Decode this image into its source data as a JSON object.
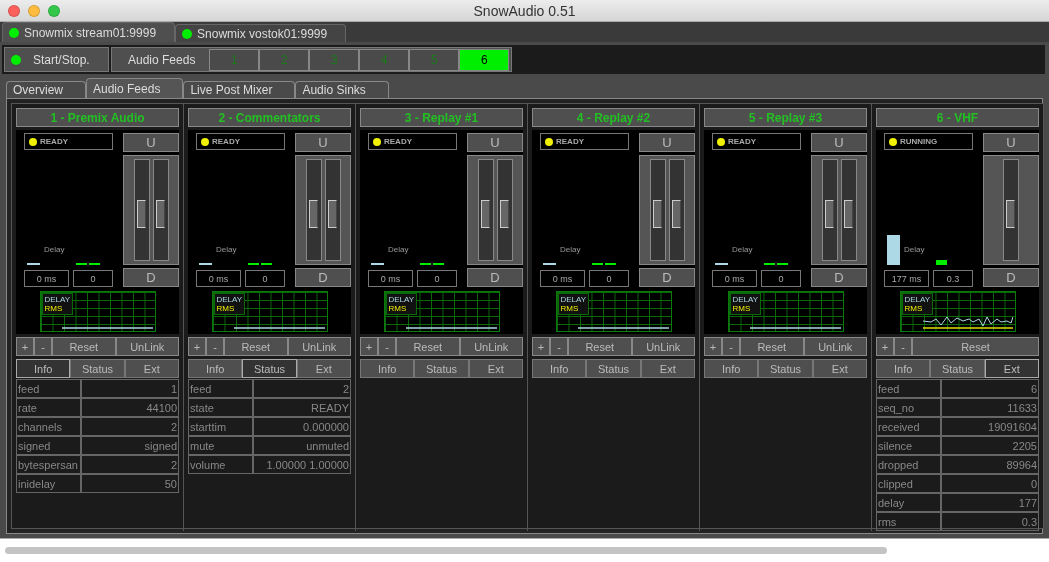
{
  "window": {
    "title": "SnowAudio 0.51"
  },
  "connections": [
    {
      "label": "Snowmix stream01:9999",
      "selected": true
    },
    {
      "label": "Snowmix vostok01:9999",
      "selected": false
    }
  ],
  "toolbar": {
    "start_stop": "Start/Stop.",
    "feeds_label": "Audio Feeds",
    "feed_buttons": [
      {
        "label": "1",
        "selected": false
      },
      {
        "label": "2",
        "selected": false
      },
      {
        "label": "3",
        "selected": false
      },
      {
        "label": "4",
        "selected": false
      },
      {
        "label": "5",
        "selected": false
      },
      {
        "label": "6",
        "selected": true
      }
    ]
  },
  "tabs": [
    {
      "label": "Overview",
      "selected": false
    },
    {
      "label": "Audio Feeds",
      "selected": true
    },
    {
      "label": "Live Post Mixer",
      "selected": false
    },
    {
      "label": "Audio Sinks",
      "selected": false
    }
  ],
  "feeds": [
    {
      "title": "1 - Premix Audio",
      "status": "READY",
      "up": "U",
      "down": "D",
      "faders": [
        {
          "level": 0.5
        },
        {
          "level": 0.5
        }
      ],
      "delay_label": "Delay",
      "delay": "0 ms",
      "rms": "0",
      "legend": [
        "DELAY",
        "RMS"
      ],
      "signal": false,
      "buttons": [
        "+",
        "-",
        "Reset",
        "UnLink"
      ],
      "tabs": [
        {
          "label": "Info",
          "selected": true
        },
        {
          "label": "Status",
          "selected": false
        },
        {
          "label": "Ext",
          "selected": false
        }
      ],
      "table": [
        {
          "key": "feed",
          "value": "1"
        },
        {
          "key": "rate",
          "value": "44100"
        },
        {
          "key": "channels",
          "value": "2"
        },
        {
          "key": "signed",
          "value": "signed"
        },
        {
          "key": "bytespersan",
          "value": "2"
        },
        {
          "key": "inidelay",
          "value": "50"
        }
      ]
    },
    {
      "title": "2 - Commentators",
      "status": "READY",
      "up": "U",
      "down": "D",
      "faders": [
        {
          "level": 0.5
        },
        {
          "level": 0.5
        }
      ],
      "delay_label": "Delay",
      "delay": "0 ms",
      "rms": "0",
      "legend": [
        "DELAY",
        "RMS"
      ],
      "signal": false,
      "buttons": [
        "+",
        "-",
        "Reset",
        "UnLink"
      ],
      "tabs": [
        {
          "label": "Info",
          "selected": false
        },
        {
          "label": "Status",
          "selected": true
        },
        {
          "label": "Ext",
          "selected": false
        }
      ],
      "table": [
        {
          "key": "feed",
          "value": "2"
        },
        {
          "key": "state",
          "value": "READY"
        },
        {
          "key": "starttim",
          "value": "0.000000"
        },
        {
          "key": "mute",
          "value": "unmuted"
        },
        {
          "key": "volume",
          "value": "1.00000 1.00000"
        }
      ]
    },
    {
      "title": "3 - Replay #1",
      "status": "READY",
      "up": "U",
      "down": "D",
      "faders": [
        {
          "level": 0.5
        },
        {
          "level": 0.5
        }
      ],
      "delay_label": "Delay",
      "delay": "0 ms",
      "rms": "0",
      "legend": [
        "DELAY",
        "RMS"
      ],
      "signal": false,
      "buttons": [
        "+",
        "-",
        "Reset",
        "UnLink"
      ],
      "tabs": [
        {
          "label": "Info",
          "selected": false
        },
        {
          "label": "Status",
          "selected": false
        },
        {
          "label": "Ext",
          "selected": false
        }
      ]
    },
    {
      "title": "4 - Replay #2",
      "status": "READY",
      "up": "U",
      "down": "D",
      "faders": [
        {
          "level": 0.5
        },
        {
          "level": 0.5
        }
      ],
      "delay_label": "Delay",
      "delay": "0 ms",
      "rms": "0",
      "legend": [
        "DELAY",
        "RMS"
      ],
      "signal": false,
      "buttons": [
        "+",
        "-",
        "Reset",
        "UnLink"
      ],
      "tabs": [
        {
          "label": "Info",
          "selected": false
        },
        {
          "label": "Status",
          "selected": false
        },
        {
          "label": "Ext",
          "selected": false
        }
      ]
    },
    {
      "title": "5 - Replay #3",
      "status": "READY",
      "up": "U",
      "down": "D",
      "faders": [
        {
          "level": 0.5
        },
        {
          "level": 0.5
        }
      ],
      "delay_label": "Delay",
      "delay": "0 ms",
      "rms": "0",
      "legend": [
        "DELAY",
        "RMS"
      ],
      "signal": false,
      "buttons": [
        "+",
        "-",
        "Reset",
        "UnLink"
      ],
      "tabs": [
        {
          "label": "Info",
          "selected": false
        },
        {
          "label": "Status",
          "selected": false
        },
        {
          "label": "Ext",
          "selected": false
        }
      ]
    },
    {
      "title": "6 - VHF",
      "status": "RUNNING",
      "up": "U",
      "down": "D",
      "faders": [
        {
          "level": 0.5
        }
      ],
      "delay_label": "Delay",
      "delay": "177 ms",
      "rms": "0.3",
      "legend": [
        "DELAY",
        "RMS"
      ],
      "signal": true,
      "buttons": [
        "+",
        "-",
        "Reset"
      ],
      "tabs": [
        {
          "label": "Info",
          "selected": false
        },
        {
          "label": "Status",
          "selected": false
        },
        {
          "label": "Ext",
          "selected": true
        }
      ],
      "table": [
        {
          "key": "feed",
          "value": "6"
        },
        {
          "key": "seq_no",
          "value": "11633"
        },
        {
          "key": "received",
          "value": "19091604"
        },
        {
          "key": "silence",
          "value": "2205"
        },
        {
          "key": "dropped",
          "value": "89964"
        },
        {
          "key": "clipped",
          "value": "0"
        },
        {
          "key": "delay",
          "value": "177"
        },
        {
          "key": "rms",
          "value": "0.3"
        }
      ]
    }
  ]
}
